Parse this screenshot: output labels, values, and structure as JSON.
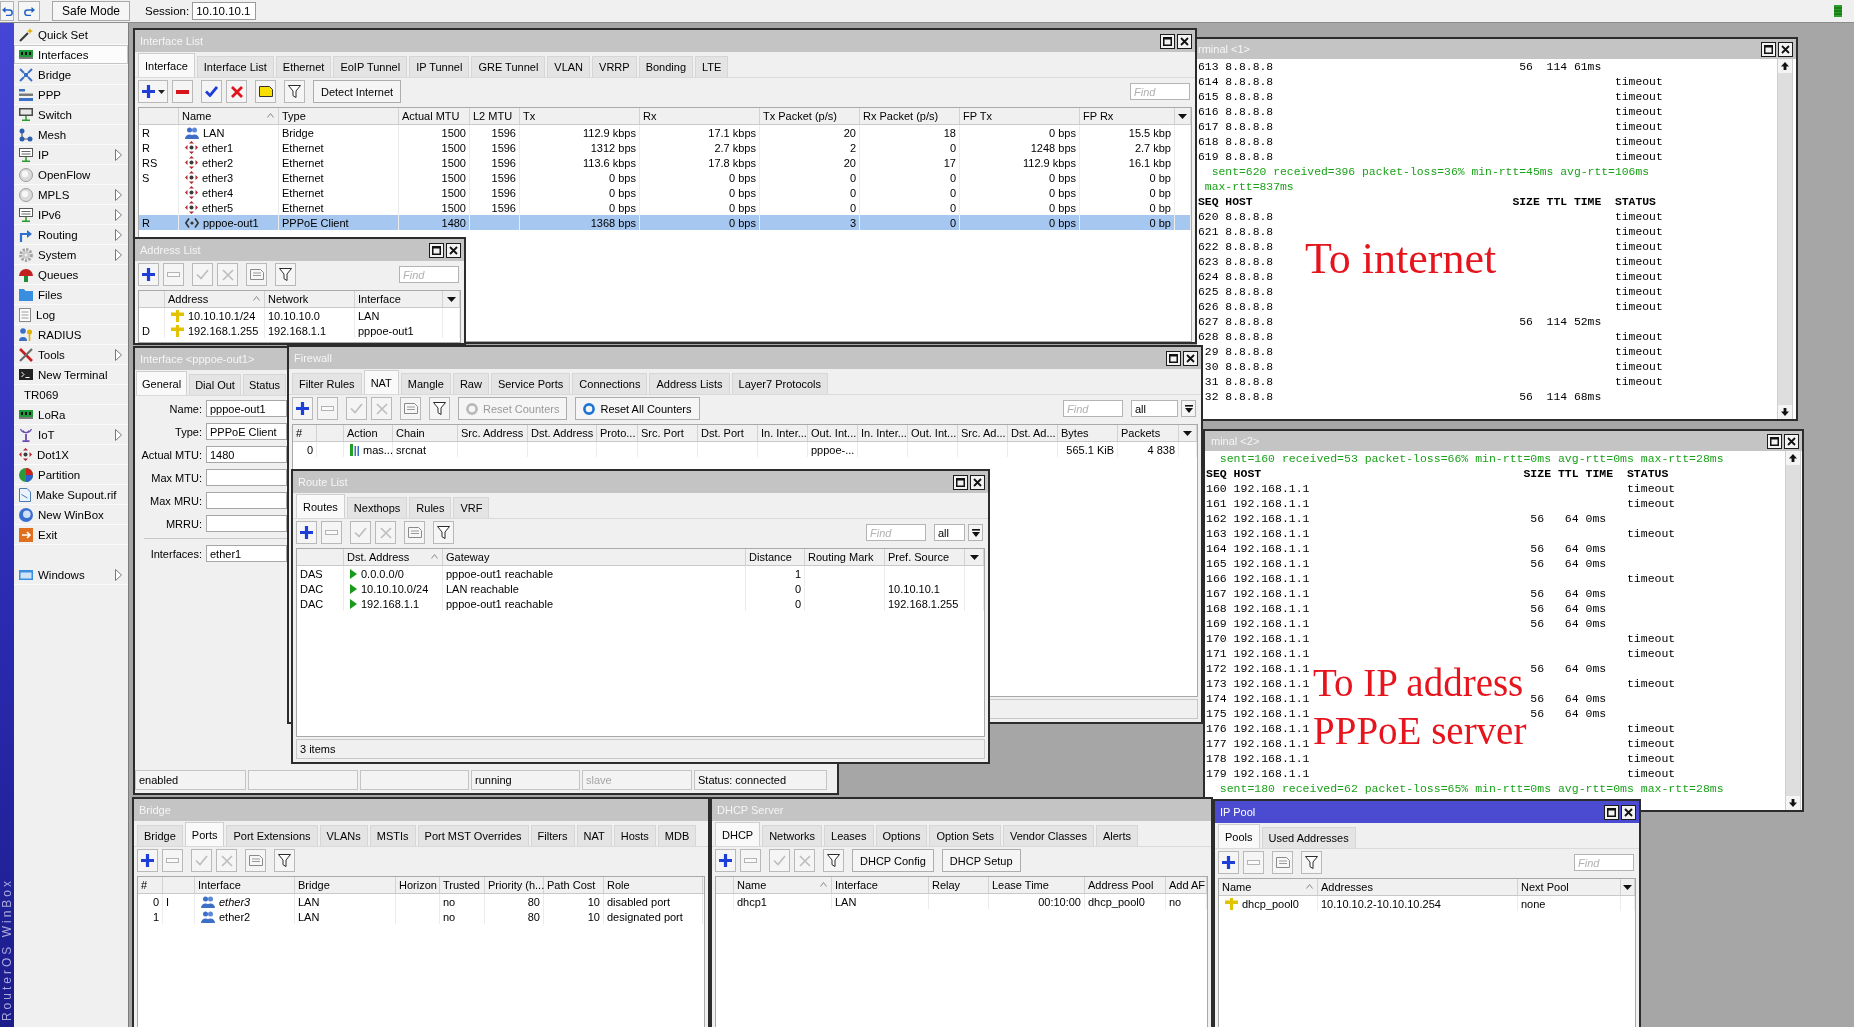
{
  "top_bar": {
    "safe_mode": "Safe Mode",
    "session_label": "Session:",
    "session": "10.10.10.1"
  },
  "brand": "RouterOS WinBox",
  "sidebar": {
    "items": [
      {
        "label": "Quick Set",
        "submenu": false,
        "selected": false
      },
      {
        "label": "Interfaces",
        "submenu": false,
        "selected": true
      },
      {
        "label": "Bridge",
        "submenu": false,
        "selected": false
      },
      {
        "label": "PPP",
        "submenu": false,
        "selected": false
      },
      {
        "label": "Switch",
        "submenu": false,
        "selected": false
      },
      {
        "label": "Mesh",
        "submenu": false,
        "selected": false
      },
      {
        "label": "IP",
        "submenu": true,
        "selected": false
      },
      {
        "label": "OpenFlow",
        "submenu": false,
        "selected": false
      },
      {
        "label": "MPLS",
        "submenu": true,
        "selected": false
      },
      {
        "label": "IPv6",
        "submenu": true,
        "selected": false
      },
      {
        "label": "Routing",
        "submenu": true,
        "selected": false
      },
      {
        "label": "System",
        "submenu": true,
        "selected": false
      },
      {
        "label": "Queues",
        "submenu": false,
        "selected": false
      },
      {
        "label": "Files",
        "submenu": false,
        "selected": false
      },
      {
        "label": "Log",
        "submenu": false,
        "selected": false
      },
      {
        "label": "RADIUS",
        "submenu": false,
        "selected": false
      },
      {
        "label": "Tools",
        "submenu": true,
        "selected": false
      },
      {
        "label": "New Terminal",
        "submenu": false,
        "selected": false
      },
      {
        "label": "TR069",
        "submenu": false,
        "selected": false
      },
      {
        "label": "LoRa",
        "submenu": false,
        "selected": false
      },
      {
        "label": "IoT",
        "submenu": true,
        "selected": false
      },
      {
        "label": "Dot1X",
        "submenu": false,
        "selected": false
      },
      {
        "label": "Partition",
        "submenu": false,
        "selected": false
      },
      {
        "label": "Make Supout.rif",
        "submenu": false,
        "selected": false
      },
      {
        "label": "New WinBox",
        "submenu": false,
        "selected": false
      },
      {
        "label": "Exit",
        "submenu": false,
        "selected": false
      }
    ],
    "bottom_items": [
      {
        "label": "Windows",
        "submenu": true,
        "selected": false
      }
    ]
  },
  "windows": {
    "interface_list": {
      "title": "Interface List",
      "active": false,
      "tabs": [
        {
          "label": "Interface",
          "selected": true
        },
        {
          "label": "Interface List",
          "selected": false
        },
        {
          "label": "Ethernet",
          "selected": false
        },
        {
          "label": "EoIP Tunnel",
          "selected": false
        },
        {
          "label": "IP Tunnel",
          "selected": false
        },
        {
          "label": "GRE Tunnel",
          "selected": false
        },
        {
          "label": "VLAN",
          "selected": false
        },
        {
          "label": "VRRP",
          "selected": false
        },
        {
          "label": "Bonding",
          "selected": false
        },
        {
          "label": "LTE",
          "selected": false
        }
      ],
      "toolbar": [
        {
          "kind": "add_menu",
          "disabled": false
        },
        {
          "kind": "remove",
          "disabled": false
        },
        {
          "kind": "enable",
          "disabled": false
        },
        {
          "kind": "disable",
          "disabled": false
        },
        {
          "kind": "comment",
          "disabled": false
        },
        {
          "kind": "filter",
          "disabled": false
        },
        {
          "kind": "text",
          "label": "Detect Internet",
          "disabled": false
        }
      ],
      "find": {
        "placeholder": "Find"
      },
      "columns": [
        {
          "label": "Name",
          "sorted": true
        },
        {
          "label": "Type",
          "sorted": false
        },
        {
          "label": "Actual MTU",
          "sorted": false
        },
        {
          "label": "L2 MTU",
          "sorted": false
        },
        {
          "label": "Tx",
          "sorted": false
        },
        {
          "label": "Rx",
          "sorted": false
        },
        {
          "label": "Tx Packet (p/s)",
          "sorted": false
        },
        {
          "label": "Rx Packet (p/s)",
          "sorted": false
        },
        {
          "label": "FP Tx",
          "sorted": false
        },
        {
          "label": "FP Rx",
          "sorted": false
        }
      ],
      "rows": [
        {
          "flags": "R",
          "kind": "bridge",
          "name": "LAN",
          "type": "Bridge",
          "actual_mtu": "1500",
          "l2_mtu": "1596",
          "tx": "112.9 kbps",
          "rx": "17.1 kbps",
          "tx_packet": "20",
          "rx_packet": "18",
          "fp_tx": "0 bps",
          "fp_rx": "15.5 kbp",
          "selected": false
        },
        {
          "flags": "R",
          "kind": "ethernet",
          "name": "ether1",
          "type": "Ethernet",
          "actual_mtu": "1500",
          "l2_mtu": "1596",
          "tx": "1312 bps",
          "rx": "2.7 kbps",
          "tx_packet": "2",
          "rx_packet": "0",
          "fp_tx": "1248 bps",
          "fp_rx": "2.7 kbp",
          "selected": false
        },
        {
          "flags": "RS",
          "kind": "ethernet",
          "name": "ether2",
          "type": "Ethernet",
          "actual_mtu": "1500",
          "l2_mtu": "1596",
          "tx": "113.6 kbps",
          "rx": "17.8 kbps",
          "tx_packet": "20",
          "rx_packet": "17",
          "fp_tx": "112.9 kbps",
          "fp_rx": "16.1 kbp",
          "selected": false
        },
        {
          "flags": "S",
          "kind": "ethernet",
          "name": "ether3",
          "type": "Ethernet",
          "actual_mtu": "1500",
          "l2_mtu": "1596",
          "tx": "0 bps",
          "rx": "0 bps",
          "tx_packet": "0",
          "rx_packet": "0",
          "fp_tx": "0 bps",
          "fp_rx": "0 bp",
          "selected": false
        },
        {
          "kind": "ethernet",
          "name": "ether4",
          "type": "Ethernet",
          "actual_mtu": "1500",
          "l2_mtu": "1596",
          "tx": "0 bps",
          "rx": "0 bps",
          "tx_packet": "0",
          "rx_packet": "0",
          "fp_tx": "0 bps",
          "fp_rx": "0 bp",
          "selected": false
        },
        {
          "kind": "ethernet",
          "name": "ether5",
          "type": "Ethernet",
          "actual_mtu": "1500",
          "l2_mtu": "1596",
          "tx": "0 bps",
          "rx": "0 bps",
          "tx_packet": "0",
          "rx_packet": "0",
          "fp_tx": "0 bps",
          "fp_rx": "0 bp",
          "selected": false
        },
        {
          "flags": "R",
          "kind": "pppoe",
          "name": "pppoe-out1",
          "type": "PPPoE Client",
          "actual_mtu": "1480",
          "tx": "1368 bps",
          "rx": "0 bps",
          "tx_packet": "3",
          "rx_packet": "0",
          "fp_tx": "0 bps",
          "fp_rx": "0 bp",
          "selected": true
        }
      ]
    },
    "terminal_1": {
      "title": "rminal <1>",
      "active": false,
      "lines": [
        {
          "kind": "row",
          "seq": "613",
          "host": "8.8.8.8",
          "size": "56",
          "ttl": "114",
          "time": "61ms"
        },
        {
          "kind": "row",
          "seq": "614",
          "host": "8.8.8.8",
          "status": "timeout"
        },
        {
          "kind": "row",
          "seq": "615",
          "host": "8.8.8.8",
          "status": "timeout"
        },
        {
          "kind": "row",
          "seq": "616",
          "host": "8.8.8.8",
          "status": "timeout"
        },
        {
          "kind": "row",
          "seq": "617",
          "host": "8.8.8.8",
          "status": "timeout"
        },
        {
          "kind": "row",
          "seq": "618",
          "host": "8.8.8.8",
          "status": "timeout"
        },
        {
          "kind": "row",
          "seq": "619",
          "host": "8.8.8.8",
          "status": "timeout"
        },
        {
          "kind": "summary",
          "text": "sent=620 received=396 packet-loss=36% min-rtt=45ms avg-rtt=106ms"
        },
        {
          "kind": "continuation",
          "text": "max-rtt=837ms"
        },
        {
          "kind": "header",
          "seq": "SEQ",
          "host": "HOST",
          "size": "SIZE",
          "ttl": "TTL",
          "time": "TIME",
          "status": "STATUS"
        },
        {
          "kind": "row",
          "seq": "620",
          "host": "8.8.8.8",
          "status": "timeout"
        },
        {
          "kind": "row",
          "seq": "621",
          "host": "8.8.8.8",
          "status": "timeout"
        },
        {
          "kind": "row",
          "seq": "622",
          "host": "8.8.8.8",
          "status": "timeout"
        },
        {
          "kind": "row",
          "seq": "623",
          "host": "8.8.8.8",
          "status": "timeout"
        },
        {
          "kind": "row",
          "seq": "624",
          "host": "8.8.8.8",
          "status": "timeout"
        },
        {
          "kind": "row",
          "seq": "625",
          "host": "8.8.8.8",
          "status": "timeout"
        },
        {
          "kind": "row",
          "seq": "626",
          "host": "8.8.8.8",
          "status": "timeout"
        },
        {
          "kind": "row",
          "seq": "627",
          "host": "8.8.8.8",
          "size": "56",
          "ttl": "114",
          "time": "52ms"
        },
        {
          "kind": "row",
          "seq": "628",
          "host": "8.8.8.8",
          "status": "timeout"
        },
        {
          "kind": "row",
          "seq": "29",
          "host": "8.8.8.8",
          "status": "timeout"
        },
        {
          "kind": "row",
          "seq": "30",
          "host": "8.8.8.8",
          "status": "timeout"
        },
        {
          "kind": "row",
          "seq": "31",
          "host": "8.8.8.8",
          "status": "timeout"
        },
        {
          "kind": "row",
          "seq": "32",
          "host": "8.8.8.8",
          "size": "56",
          "ttl": "114",
          "time": "68ms"
        }
      ],
      "annotation": [
        "To internet"
      ]
    },
    "address_list": {
      "title": "Address List",
      "active": false,
      "toolbar": [
        {
          "kind": "add",
          "disabled": false
        },
        {
          "kind": "remove",
          "disabled": true
        },
        {
          "kind": "enable",
          "disabled": true
        },
        {
          "kind": "disable",
          "disabled": true
        },
        {
          "kind": "comment",
          "disabled": true
        },
        {
          "kind": "filter",
          "disabled": false
        }
      ],
      "find": {
        "placeholder": "Find"
      },
      "columns": [
        {
          "label": "Address",
          "sorted": true
        },
        {
          "label": "Network",
          "sorted": false
        },
        {
          "label": "Interface",
          "sorted": false
        }
      ],
      "rows": [
        {
          "address": "10.10.10.1/24",
          "network": "10.10.10.0",
          "interface": "LAN"
        },
        {
          "flags": "D",
          "address": "192.168.1.255",
          "network": "192.168.1.1",
          "interface": "pppoe-out1"
        }
      ]
    },
    "interface_editor": {
      "title": "Interface <pppoe-out1>",
      "active": false,
      "tabs": [
        {
          "label": "General",
          "selected": true
        },
        {
          "label": "Dial Out",
          "selected": false
        },
        {
          "label": "Status",
          "selected": false
        }
      ],
      "fields": [
        {
          "label": "Name:",
          "value": "pppoe-out1"
        },
        {
          "label": "Type:",
          "value": "PPPoE Client"
        },
        {
          "label": "Actual MTU:",
          "value": "1480"
        },
        {
          "label": "Max MTU:"
        },
        {
          "label": "Max MRU:"
        },
        {
          "label": "MRRU:"
        }
      ],
      "interfaces": {
        "label": "Interfaces:",
        "value": "ether1"
      },
      "status_bar": [
        {
          "kind": "text",
          "text": "enabled",
          "disabled": false
        },
        {
          "kind": "blank"
        },
        {
          "kind": "blank"
        },
        {
          "kind": "text",
          "text": "running",
          "disabled": false
        },
        {
          "kind": "text",
          "text": "slave",
          "disabled": true
        },
        {
          "kind": "text",
          "text": "Status: connected",
          "disabled": false
        }
      ]
    },
    "firewall": {
      "title": "Firewall",
      "active": false,
      "tabs": [
        {
          "label": "Filter Rules",
          "selected": false
        },
        {
          "label": "NAT",
          "selected": true
        },
        {
          "label": "Mangle",
          "selected": false
        },
        {
          "label": "Raw",
          "selected": false
        },
        {
          "label": "Service Ports",
          "selected": false
        },
        {
          "label": "Connections",
          "selected": false
        },
        {
          "label": "Address Lists",
          "selected": false
        },
        {
          "label": "Layer7 Protocols",
          "selected": false
        }
      ],
      "toolbar": [
        {
          "kind": "add",
          "disabled": false
        },
        {
          "kind": "remove",
          "disabled": true
        },
        {
          "kind": "enable",
          "disabled": true
        },
        {
          "kind": "disable",
          "disabled": true
        },
        {
          "kind": "comment",
          "disabled": true
        },
        {
          "kind": "filter",
          "disabled": false
        },
        {
          "kind": "reset",
          "label": "Reset Counters",
          "disabled": true
        },
        {
          "kind": "reset",
          "label": "Reset All Counters",
          "disabled": false
        }
      ],
      "find": {
        "placeholder": "Find"
      },
      "scope": "all",
      "columns": [
        {
          "label": "#",
          "sorted": false
        },
        {
          "label": "Action",
          "sorted": false
        },
        {
          "label": "Chain",
          "sorted": false
        },
        {
          "label": "Src. Address",
          "sorted": false
        },
        {
          "label": "Dst. Address",
          "sorted": false
        },
        {
          "label": "Proto...",
          "sorted": false
        },
        {
          "label": "Src. Port",
          "sorted": false
        },
        {
          "label": "Dst. Port",
          "sorted": false
        },
        {
          "label": "In. Inter...",
          "sorted": false
        },
        {
          "label": "Out. Int...",
          "sorted": false
        },
        {
          "label": "In. Inter...",
          "sorted": false
        },
        {
          "label": "Out. Int...",
          "sorted": false
        },
        {
          "label": "Src. Ad...",
          "sorted": false
        },
        {
          "label": "Dst. Ad...",
          "sorted": false
        },
        {
          "label": "Bytes",
          "sorted": false
        },
        {
          "label": "Packets",
          "sorted": false
        }
      ],
      "rows": [
        {
          "number": "0",
          "action": "mas...",
          "chain": "srcnat",
          "out_interface": "pppoe-...",
          "bytes": "565.1 KiB",
          "packets": "4 838"
        }
      ]
    },
    "route_list": {
      "title": "Route List",
      "active": false,
      "tabs": [
        {
          "label": "Routes",
          "selected": true
        },
        {
          "label": "Nexthops",
          "selected": false
        },
        {
          "label": "Rules",
          "selected": false
        },
        {
          "label": "VRF",
          "selected": false
        }
      ],
      "toolbar": [
        {
          "kind": "add",
          "disabled": false
        },
        {
          "kind": "remove",
          "disabled": true
        },
        {
          "kind": "enable",
          "disabled": true
        },
        {
          "kind": "disable",
          "disabled": true
        },
        {
          "kind": "comment",
          "disabled": true
        },
        {
          "kind": "filter",
          "disabled": false
        }
      ],
      "find": {
        "placeholder": "Find"
      },
      "scope": "all",
      "columns": [
        {
          "label": "Dst. Address",
          "sorted": true
        },
        {
          "label": "Gateway",
          "sorted": false
        },
        {
          "label": "Distance",
          "sorted": false
        },
        {
          "label": "Routing Mark",
          "sorted": false
        },
        {
          "label": "Pref. Source",
          "sorted": false
        }
      ],
      "rows": [
        {
          "flags": "DAS",
          "dst_address": "0.0.0.0/0",
          "gateway": "pppoe-out1 reachable",
          "distance": "1"
        },
        {
          "flags": "DAC",
          "dst_address": "10.10.10.0/24",
          "gateway": "LAN reachable",
          "distance": "0",
          "pref_source": "10.10.10.1"
        },
        {
          "flags": "DAC",
          "dst_address": "192.168.1.1",
          "gateway": "pppoe-out1 reachable",
          "distance": "0",
          "pref_source": "192.168.1.255"
        }
      ],
      "status": "3 items"
    },
    "terminal_2": {
      "title": "minal <2>",
      "active": false,
      "lines": [
        {
          "kind": "summary",
          "text": "sent=160 received=53 packet-loss=66% min-rtt=0ms avg-rtt=0ms max-rtt=28ms"
        },
        {
          "kind": "header",
          "seq": "SEQ",
          "host": "HOST",
          "size": "SIZE",
          "ttl": "TTL",
          "time": "TIME",
          "status": "STATUS"
        },
        {
          "kind": "row",
          "seq": "160",
          "host": "192.168.1.1",
          "status": "timeout"
        },
        {
          "kind": "row",
          "seq": "161",
          "host": "192.168.1.1",
          "status": "timeout"
        },
        {
          "kind": "row",
          "seq": "162",
          "host": "192.168.1.1",
          "size": "56",
          "ttl": "64",
          "time": "0ms"
        },
        {
          "kind": "row",
          "seq": "163",
          "host": "192.168.1.1",
          "status": "timeout"
        },
        {
          "kind": "row",
          "seq": "164",
          "host": "192.168.1.1",
          "size": "56",
          "ttl": "64",
          "time": "0ms"
        },
        {
          "kind": "row",
          "seq": "165",
          "host": "192.168.1.1",
          "size": "56",
          "ttl": "64",
          "time": "0ms"
        },
        {
          "kind": "row",
          "seq": "166",
          "host": "192.168.1.1",
          "status": "timeout"
        },
        {
          "kind": "row",
          "seq": "167",
          "host": "192.168.1.1",
          "size": "56",
          "ttl": "64",
          "time": "0ms"
        },
        {
          "kind": "row",
          "seq": "168",
          "host": "192.168.1.1",
          "size": "56",
          "ttl": "64",
          "time": "0ms"
        },
        {
          "kind": "row",
          "seq": "169",
          "host": "192.168.1.1",
          "size": "56",
          "ttl": "64",
          "time": "0ms"
        },
        {
          "kind": "row",
          "seq": "170",
          "host": "192.168.1.1",
          "status": "timeout"
        },
        {
          "kind": "row",
          "seq": "171",
          "host": "192.168.1.1",
          "status": "timeout"
        },
        {
          "kind": "row",
          "seq": "172",
          "host": "192.168.1.1",
          "size": "56",
          "ttl": "64",
          "time": "0ms"
        },
        {
          "kind": "row",
          "seq": "173",
          "host": "192.168.1.1",
          "status": "timeout"
        },
        {
          "kind": "row",
          "seq": "174",
          "host": "192.168.1.1",
          "size": "56",
          "ttl": "64",
          "time": "0ms"
        },
        {
          "kind": "row",
          "seq": "175",
          "host": "192.168.1.1",
          "size": "56",
          "ttl": "64",
          "time": "0ms"
        },
        {
          "kind": "row",
          "seq": "176",
          "host": "192.168.1.1",
          "status": "timeout"
        },
        {
          "kind": "row",
          "seq": "177",
          "host": "192.168.1.1",
          "status": "timeout"
        },
        {
          "kind": "row",
          "seq": "178",
          "host": "192.168.1.1",
          "status": "timeout"
        },
        {
          "kind": "row",
          "seq": "179",
          "host": "192.168.1.1",
          "status": "timeout"
        },
        {
          "kind": "summary",
          "text": "sent=180 received=62 packet-loss=65% min-rtt=0ms avg-rtt=0ms max-rtt=28ms"
        }
      ],
      "annotation": [
        "To IP address",
        "PPPoE server"
      ]
    },
    "bridge": {
      "title": "Bridge",
      "active": false,
      "tabs": [
        {
          "label": "Bridge",
          "selected": false
        },
        {
          "label": "Ports",
          "selected": true
        },
        {
          "label": "Port Extensions",
          "selected": false
        },
        {
          "label": "VLANs",
          "selected": false
        },
        {
          "label": "MSTIs",
          "selected": false
        },
        {
          "label": "Port MST Overrides",
          "selected": false
        },
        {
          "label": "Filters",
          "selected": false
        },
        {
          "label": "NAT",
          "selected": false
        },
        {
          "label": "Hosts",
          "selected": false
        },
        {
          "label": "MDB",
          "selected": false
        }
      ],
      "toolbar": [
        {
          "kind": "add",
          "disabled": false
        },
        {
          "kind": "remove",
          "disabled": true
        },
        {
          "kind": "enable",
          "disabled": true
        },
        {
          "kind": "disable",
          "disabled": true
        },
        {
          "kind": "comment",
          "disabled": true
        },
        {
          "kind": "filter",
          "disabled": false
        }
      ],
      "columns": [
        {
          "label": "#",
          "sorted": false
        },
        {
          "label": "Interface",
          "sorted": false
        },
        {
          "label": "Bridge",
          "sorted": false
        },
        {
          "label": "Horizon",
          "sorted": false
        },
        {
          "label": "Trusted",
          "sorted": false
        },
        {
          "label": "Priority (h...",
          "sorted": false
        },
        {
          "label": "Path Cost",
          "sorted": false
        },
        {
          "label": "Role",
          "sorted": false
        }
      ],
      "rows": [
        {
          "number": "0",
          "flags": "I",
          "interface": "ether3",
          "inactive": true,
          "bridge": "LAN",
          "trusted": "no",
          "priority": "80",
          "path_cost": "10",
          "role": "disabled port"
        },
        {
          "number": "1",
          "interface": "ether2",
          "inactive": false,
          "bridge": "LAN",
          "trusted": "no",
          "priority": "80",
          "path_cost": "10",
          "role": "designated port"
        }
      ]
    },
    "dhcp_server": {
      "title": "DHCP Server",
      "active": false,
      "tabs": [
        {
          "label": "DHCP",
          "selected": true
        },
        {
          "label": "Networks",
          "selected": false
        },
        {
          "label": "Leases",
          "selected": false
        },
        {
          "label": "Options",
          "selected": false
        },
        {
          "label": "Option Sets",
          "selected": false
        },
        {
          "label": "Vendor Classes",
          "selected": false
        },
        {
          "label": "Alerts",
          "selected": false
        }
      ],
      "toolbar": [
        {
          "kind": "add",
          "disabled": false
        },
        {
          "kind": "remove",
          "disabled": true
        },
        {
          "kind": "enable",
          "disabled": true
        },
        {
          "kind": "disable",
          "disabled": true
        },
        {
          "kind": "filter",
          "disabled": false
        },
        {
          "kind": "text",
          "label": "DHCP Config",
          "disabled": false
        },
        {
          "kind": "text",
          "label": "DHCP Setup",
          "disabled": false
        }
      ],
      "columns": [
        {
          "label": "Name",
          "sorted": true
        },
        {
          "label": "Interface",
          "sorted": false
        },
        {
          "label": "Relay",
          "sorted": false
        },
        {
          "label": "Lease Time",
          "sorted": false
        },
        {
          "label": "Address Pool",
          "sorted": false
        },
        {
          "label": "Add AF",
          "sorted": false
        }
      ],
      "rows": [
        {
          "name": "dhcp1",
          "interface": "LAN",
          "lease_time": "00:10:00",
          "address_pool": "dhcp_pool0",
          "add_arp": "no"
        }
      ]
    },
    "ip_pool": {
      "title": "IP Pool",
      "active": true,
      "tabs": [
        {
          "label": "Pools",
          "selected": true
        },
        {
          "label": "Used Addresses",
          "selected": false
        }
      ],
      "toolbar": [
        {
          "kind": "add",
          "disabled": false
        },
        {
          "kind": "remove",
          "disabled": true
        },
        {
          "kind": "comment",
          "disabled": true
        },
        {
          "kind": "filter",
          "disabled": false
        }
      ],
      "find": {
        "placeholder": "Find"
      },
      "columns": [
        {
          "label": "Name",
          "sorted": true
        },
        {
          "label": "Addresses",
          "sorted": false
        },
        {
          "label": "Next Pool",
          "sorted": false
        }
      ],
      "rows": [
        {
          "name": "dhcp_pool0",
          "addresses": "10.10.10.2-10.10.10.254",
          "next_pool": "none"
        }
      ]
    }
  }
}
